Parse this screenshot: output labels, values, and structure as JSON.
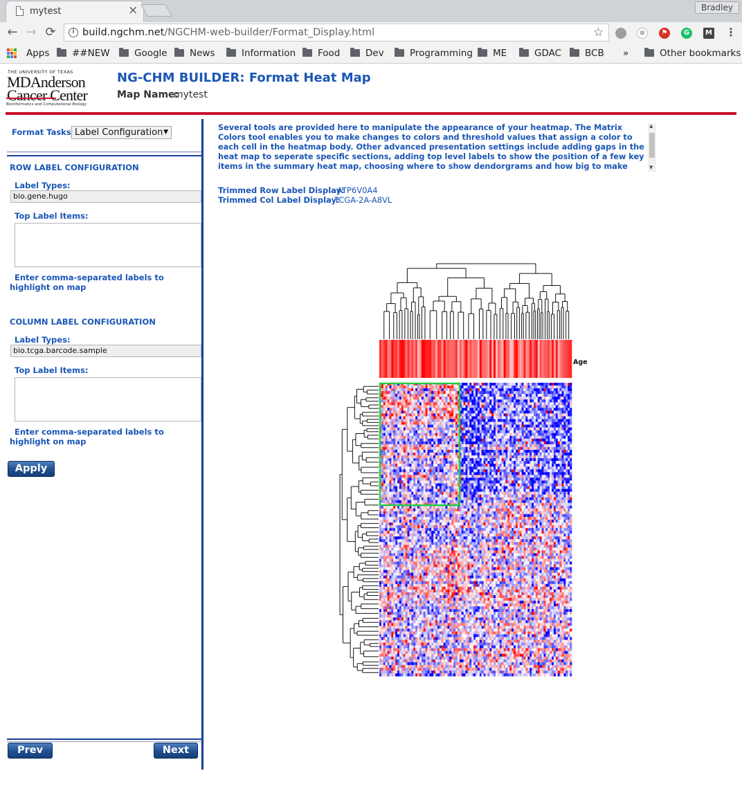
{
  "browser": {
    "tab_title": "mytest",
    "tab_close": "×",
    "user": "Bradley",
    "url_host": "build.ngchm.net",
    "url_path": "/NGCHM-web-builder/Format_Display.html",
    "back": "←",
    "forward": "→",
    "reload": "⟳",
    "star": "☆",
    "menu": "⋮",
    "bookmarks": [
      "Apps",
      "##NEW",
      "Google",
      "News",
      "Information",
      "Food",
      "Dev",
      "Programming",
      "ME",
      "GDAC",
      "BCB"
    ],
    "overflow": "»",
    "other_bookmarks": "Other bookmarks"
  },
  "header": {
    "logo_top": "THE UNIVERSITY OF TEXAS",
    "logo_line1": "MDAnderson",
    "logo_line2": "Cancer Center",
    "logo_sub": "Bioinformatics and Computational Biology",
    "title": "NG-CHM BUILDER: Format Heat Map",
    "map_name_label": "Map Name:",
    "map_name_value": "mytest"
  },
  "left_panel": {
    "tasks_label": "Format Tasks:",
    "tasks_value": "Label Configuration",
    "row_section_title": "ROW LABEL CONFIGURATION",
    "row_label_types_label": "Label Types:",
    "row_label_types_value": "bio.gene.hugo",
    "row_top_items_label": "Top Label Items:",
    "row_hint": "Enter comma-separated labels to highlight on map",
    "col_section_title": "COLUMN LABEL CONFIGURATION",
    "col_label_types_label": "Label Types:",
    "col_label_types_value": "bio.tcga.barcode.sample",
    "col_top_items_label": "Top Label Items:",
    "col_hint": "Enter comma-separated labels to highlight on map",
    "apply_button": "Apply",
    "prev_button": "Prev",
    "next_button": "Next"
  },
  "right_panel": {
    "intro": "Several tools are provided here to manipulate the appearance of your heatmap. The Matrix Colors tool enables you to make changes to colors and threshold values that assign a color to each cell in the heatmap body. Other advanced presentation settings include adding gaps in the heat map to seperate specific sections, adding top level labels to show the position of a few key items in the summary heat map, choosing where to show dendorgrams and how big to make them, selecting label truncation lengths, and identifying",
    "trimmed_row_label": "Trimmed Row Label Display:",
    "trimmed_row_value": "ATP6V0A4",
    "trimmed_col_label": "Trimmed Col Label Display:",
    "trimmed_col_value": "TCGA-2A-A8VL",
    "covariate_label": "Age"
  },
  "colors": {
    "brand_blue": "#1a56b5",
    "brand_red": "#c8102e",
    "heat_low": "#0000ff",
    "heat_mid": "#ffffff",
    "heat_high": "#ff0000",
    "selection": "#22cc44"
  }
}
